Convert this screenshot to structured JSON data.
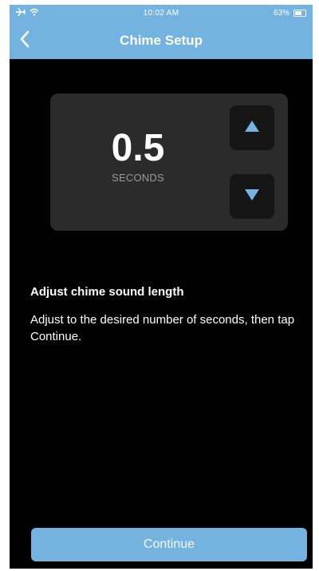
{
  "status_bar": {
    "time": "10:02 AM",
    "battery_text": "63%",
    "battery_level": 0.63,
    "icons": [
      "airplane-icon",
      "wifi-icon",
      "battery-icon"
    ]
  },
  "nav": {
    "title": "Chime Setup",
    "back_icon": "chevron-left-icon"
  },
  "stepper": {
    "value": "0.5",
    "unit": "SECONDS",
    "increase_icon": "triangle-up-icon",
    "decrease_icon": "triangle-down-icon"
  },
  "instructions": {
    "heading": "Adjust chime sound length",
    "body": "Adjust to the desired number of seconds, then tap Continue."
  },
  "footer": {
    "continue_label": "Continue"
  },
  "colors": {
    "accent": "#74b3e0",
    "background": "#000000",
    "card": "#2b2b2b",
    "step_button": "#151515",
    "muted_text": "#9a9a9a"
  }
}
